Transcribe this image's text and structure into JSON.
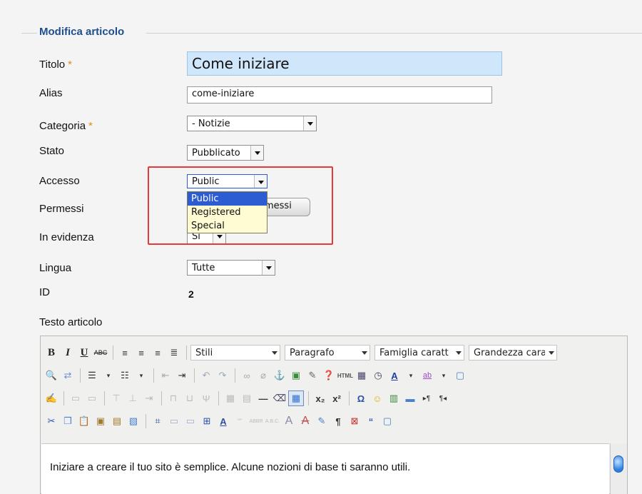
{
  "form": {
    "legend": "Modifica articolo",
    "required_mark": "*",
    "title": {
      "label": "Titolo",
      "value": "Come iniziare"
    },
    "alias": {
      "label": "Alias",
      "value": "come-iniziare"
    },
    "category": {
      "label": "Categoria",
      "value": "- Notizie"
    },
    "status": {
      "label": "Stato",
      "value": "Pubblicato"
    },
    "access": {
      "label": "Accesso",
      "value": "Public",
      "options": [
        "Public",
        "Registered",
        "Special"
      ],
      "highlighted": "Public"
    },
    "permissions": {
      "label": "Permessi",
      "button_partial": "messi"
    },
    "featured": {
      "label": "In evidenza",
      "value": "Sì"
    },
    "language": {
      "label": "Lingua",
      "value": "Tutte"
    },
    "id": {
      "label": "ID",
      "value": "2"
    },
    "article_text_label": "Testo articolo"
  },
  "editor": {
    "row1_selects": {
      "styles": "Stili",
      "paragraph": "Paragrafo",
      "font_family": "Famiglia caratt",
      "font_size": "Grandezza cara"
    },
    "content": "Iniziare a creare il tuo sito è semplice. Alcune nozioni di base ti saranno utili."
  },
  "colors": {
    "legend": "#1e4e8c",
    "required": "#e08a1a",
    "highlight_box": "#e43a3a",
    "dropdown_bg": "#fffbd2",
    "dropdown_selected": "#2d5bd1",
    "title_input_bg": "#cfe6fb"
  }
}
